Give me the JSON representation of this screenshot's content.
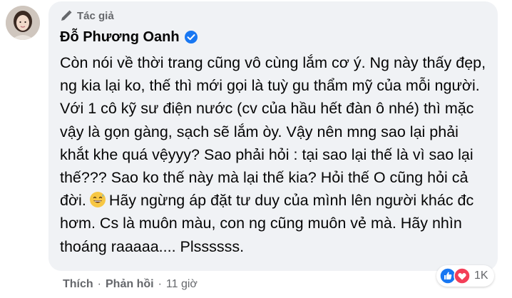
{
  "comment": {
    "author_badge": "Tác giả",
    "author_name": "Đỗ Phương Oanh",
    "text_part1": "Còn nói về thời trang cũng vô cùng lắm cơ ý. Ng này thấy đẹp, ng kia lại ko, thế thì mới gọi là tuỳ gu thẩm mỹ của mỗi người. Với 1 cô kỹ sư điện nước (cv của hầu hết đàn ô nhé) thì mặc vậy là gọn gàng, sạch sẽ lắm òy. Vậy nên mng sao lại phải khắt khe quá vệyyy? Sao phải hỏi : tại sao lại thế là vì sao lại thế??? Sao ko thế này mà lại thế kia? Hỏi thế O cũng hỏi cả đời.",
    "emoji": "grinning-sweat-emoji",
    "text_part2": "Hãy ngừng áp đặt tư duy của mình lên người khác đc hơm. Cs là muôn màu, con ng cũng muôn vẻ mà. Hãy nhìn thoáng raaaaa.... Plssssss."
  },
  "actions": {
    "like": "Thích",
    "reply": "Phản hồi",
    "separator": "·",
    "time": "11 giờ"
  },
  "reactions": {
    "icons": [
      "like-icon",
      "love-icon"
    ],
    "count": "1K"
  },
  "colors": {
    "bubble": "#f0f2f5",
    "secondary_text": "#65676b",
    "like_blue": "#1877f2",
    "love_red": "#f33e58"
  }
}
